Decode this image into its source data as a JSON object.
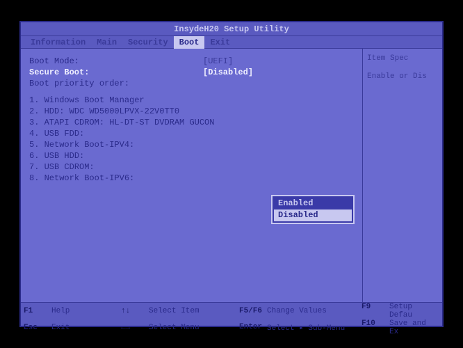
{
  "title": "InsydeH20 Setup Utility",
  "menubar": {
    "items": [
      "Information",
      "Main",
      "Security",
      "Boot",
      "Exit"
    ],
    "selected_index": 3
  },
  "settings": {
    "boot_mode": {
      "label": "Boot Mode:",
      "value": "UEFI"
    },
    "secure_boot": {
      "label": "Secure Boot:",
      "value": "Disabled"
    },
    "boot_priority": {
      "label": "Boot priority order:"
    }
  },
  "boot_order": [
    "Windows Boot Manager",
    "HDD: WDC WD5000LPVX-22V0TT0",
    "ATAPI CDROM: HL-DT-ST DVDRAM GUCON",
    "USB FDD:",
    "Network Boot-IPV4:",
    "USB HDD:",
    "USB CDROM:",
    "Network Boot-IPV6:"
  ],
  "popup": {
    "options": [
      "Enabled",
      "Disabled"
    ],
    "selected_index": 1
  },
  "right_help": {
    "title": "Item Spec",
    "text": "Enable or Dis"
  },
  "helpbar": {
    "r1": [
      {
        "key": "F1",
        "label": "Help"
      },
      {
        "key": "↑↓",
        "label": "Select Item"
      },
      {
        "key": "F5/F6",
        "label": "Change Values"
      },
      {
        "key": "F9",
        "label": "Setup Defau"
      }
    ],
    "r2": [
      {
        "key": "Esc",
        "label": "Exit"
      },
      {
        "key": "←→",
        "label": "Select Menu"
      },
      {
        "key": "Enter",
        "label": "Select ▸ Sub-Menu"
      },
      {
        "key": "F10",
        "label": "Save and Ex"
      }
    ]
  }
}
